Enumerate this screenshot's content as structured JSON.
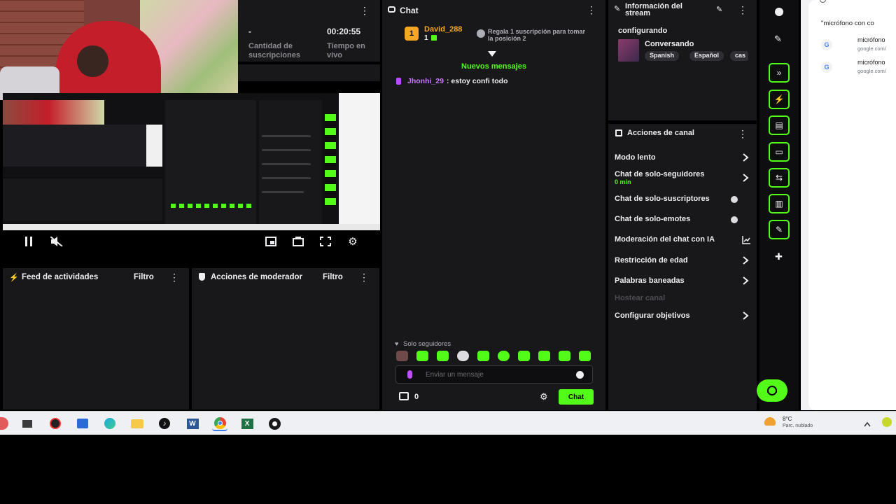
{
  "stats": {
    "subs_value": "-",
    "subs_label": "Cantidad de suscripciones",
    "time_value": "00:20:55",
    "time_label": "Tiempo en vivo"
  },
  "chat": {
    "title": "Chat",
    "pinned_user": "David_288",
    "pinned_rank": "1",
    "pinned_sub": "1",
    "pinned_note": "Regala 1 suscripción para tomar la posición 2",
    "new_messages": "Nuevos mensajes",
    "messages": [
      {
        "user": "Jhonhi_29",
        "text": ": estoy confi todo"
      }
    ],
    "followers_only": "Solo seguidores",
    "input_placeholder": "Enviar un mensaje",
    "coins": "0",
    "send_label": "Chat"
  },
  "stream_info": {
    "title": "Información del stream",
    "status": "configurando",
    "category": "Conversando",
    "tags": [
      "Spanish",
      "Español",
      "cas"
    ]
  },
  "channel_actions": {
    "title": "Acciones de canal",
    "items": [
      {
        "label": "Modo lento",
        "sub": "",
        "control": "arrow"
      },
      {
        "label": "Chat de solo-seguidores",
        "sub": "0 min",
        "control": "arrow"
      },
      {
        "label": "Chat de solo-suscriptores",
        "sub": "",
        "control": "toggle"
      },
      {
        "label": "Chat de solo-emotes",
        "sub": "",
        "control": "toggle"
      },
      {
        "label": "Moderación del chat con IA",
        "sub": "",
        "control": "chart"
      },
      {
        "label": "Restricción de edad",
        "sub": "",
        "control": "arrow"
      },
      {
        "label": "Palabras baneadas",
        "sub": "",
        "control": "arrow"
      },
      {
        "label": "Hostear canal",
        "sub": "",
        "control": "disabled"
      },
      {
        "label": "Configurar objetivos",
        "sub": "",
        "control": "arrow"
      }
    ]
  },
  "feed": {
    "title": "Feed de actividades",
    "filter": "Filtro"
  },
  "mod_actions": {
    "title": "Acciones de moderador",
    "filter": "Filtro"
  },
  "search": {
    "query": "\"micrófono con co",
    "results": [
      {
        "title": "micrófono",
        "sub": "google.com/"
      },
      {
        "title": "micrófono",
        "sub": "google.com/"
      }
    ]
  },
  "taskbar": {
    "weather_temp": "8°C",
    "weather_desc": "Parc. nublado"
  },
  "colors": {
    "accent": "#53fc18",
    "panel": "#18181b",
    "page": "#0e0e10"
  }
}
